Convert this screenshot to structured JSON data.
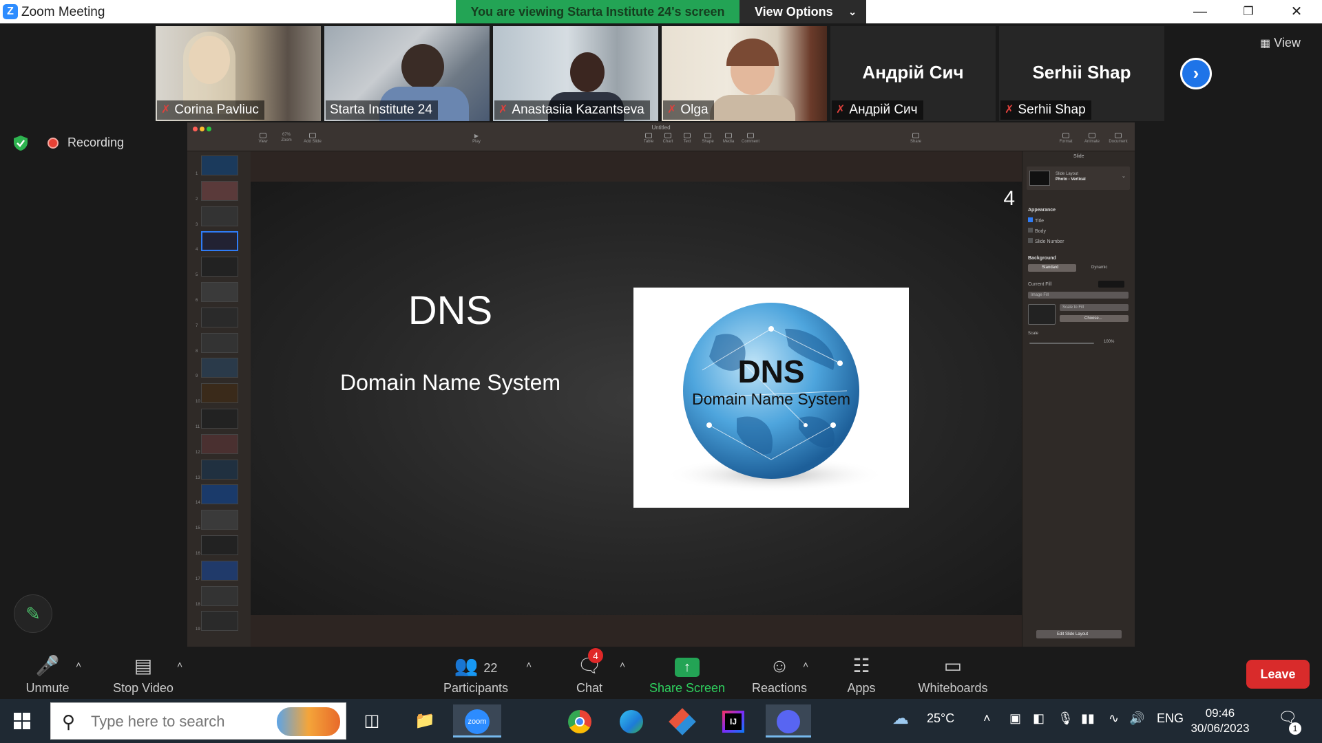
{
  "window": {
    "title": "Zoom Meeting"
  },
  "banner": {
    "viewing": "You are viewing Starta Institute 24's screen",
    "view_options": "View Options"
  },
  "participants_strip": [
    {
      "name": "Corina Pavliuc",
      "muted": true,
      "video": true
    },
    {
      "name": "Starta Institute 24",
      "muted": false,
      "video": true,
      "active": true
    },
    {
      "name": "Anastasiia Kazantseva",
      "muted": true,
      "video": true
    },
    {
      "name": "Olga",
      "muted": true,
      "video": true
    },
    {
      "name": "Андрій Сич",
      "muted": true,
      "video": false
    },
    {
      "name": "Serhii Shap",
      "muted": true,
      "video": false
    }
  ],
  "view_label": "View",
  "recording": "Recording",
  "keynote": {
    "doc_title": "Untitled",
    "toolbar_left": [
      "View",
      "Zoom",
      "Add Slide"
    ],
    "zoom_value": "67%",
    "toolbar_center": [
      "Play"
    ],
    "toolbar_insert": [
      "Table",
      "Chart",
      "Text",
      "Shape",
      "Media",
      "Comment"
    ],
    "toolbar_share": "Share",
    "toolbar_right": [
      "Format",
      "Animate",
      "Document"
    ],
    "slide_numbers": [
      "1",
      "2",
      "3",
      "4",
      "5",
      "6",
      "7",
      "8",
      "9",
      "10",
      "11",
      "12",
      "13",
      "14",
      "15",
      "16",
      "17",
      "18",
      "19"
    ],
    "selected_slide": 4,
    "slide": {
      "number": "4",
      "title": "DNS",
      "subtitle": "Domain Name System",
      "image_title": "DNS",
      "image_subtitle": "Domain Name System"
    },
    "inspector": {
      "header": "Slide",
      "layout_label": "Slide Layout",
      "layout_value": "Photo - Vertical",
      "appearance": "Appearance",
      "checks": [
        {
          "label": "Title",
          "checked": true
        },
        {
          "label": "Body",
          "checked": false
        },
        {
          "label": "Slide Number",
          "checked": false
        }
      ],
      "background": "Background",
      "bg_tabs": [
        "Standard",
        "Dynamic"
      ],
      "current_fill": "Current Fill",
      "fill_type": "Image Fill",
      "scale_mode": "Scale to Fill",
      "choose": "Choose...",
      "scale": "Scale",
      "scale_value": "100%",
      "edit_layout": "Edit Slide Layout"
    }
  },
  "toolbar": {
    "unmute": "Unmute",
    "stop_video": "Stop Video",
    "participants": "Participants",
    "participant_count": "22",
    "chat": "Chat",
    "chat_badge": "4",
    "share_screen": "Share Screen",
    "reactions": "Reactions",
    "apps": "Apps",
    "whiteboards": "Whiteboards",
    "leave": "Leave"
  },
  "taskbar": {
    "search_placeholder": "Type here to search",
    "temperature": "25°C",
    "language": "ENG",
    "time": "09:46",
    "date": "30/06/2023",
    "notification_count": "1"
  },
  "colors": {
    "zoom_blue": "#2d8cff",
    "share_green": "#23a455",
    "leave_red": "#d92b2b",
    "mute_red": "#e0413c"
  }
}
